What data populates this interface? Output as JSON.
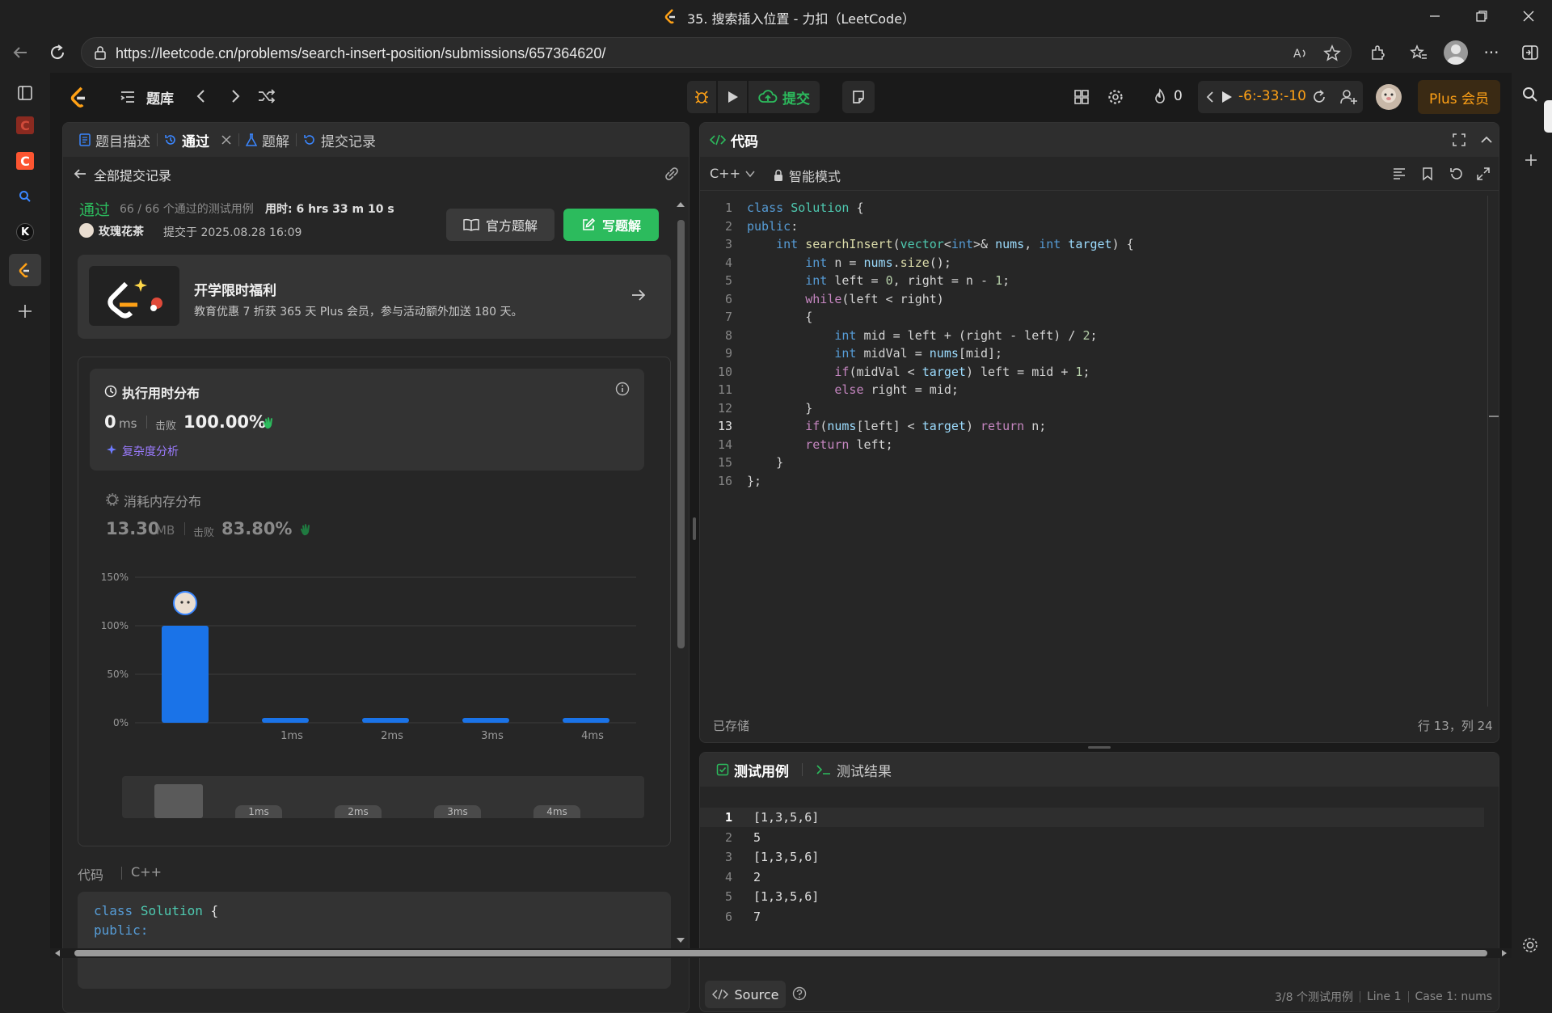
{
  "window": {
    "title": "35. 搜索插入位置 - 力扣（LeetCode）"
  },
  "browser": {
    "url": "https://leetcode.cn/problems/search-insert-position/submissions/657364620/"
  },
  "nav": {
    "problem_list": "题库",
    "submit": "提交",
    "streak": "0",
    "timer": "-6:-33:-10",
    "plus": "Plus 会员"
  },
  "left_tabs": [
    {
      "label": "题目描述"
    },
    {
      "label": "通过"
    },
    {
      "label": "题解"
    },
    {
      "label": "提交记录"
    }
  ],
  "submission": {
    "back": "全部提交记录",
    "status": "通过",
    "cases": "66 / 66 个通过的测试用例",
    "time_used": "用时: 6 hrs 33 m 10 s",
    "user": "玫瑰花茶",
    "submitted_at": "提交于 2025.08.28 16:09",
    "official_solution": "官方题解",
    "write_solution": "写题解"
  },
  "promo": {
    "title": "开学限时福利",
    "desc": "教育优惠 7 折获 365 天 Plus 会员，参与活动额外加送 180 天。"
  },
  "runtime": {
    "title": "执行用时分布",
    "value": "0",
    "unit": "ms",
    "beat_label": "击败",
    "beat": "100.00%",
    "analysis": "复杂度分析"
  },
  "memory": {
    "title": "消耗内存分布",
    "value": "13.30",
    "unit": "MB",
    "beat_label": "击败",
    "beat": "83.80%"
  },
  "chart_data": {
    "type": "bar",
    "categories": [
      "",
      "1ms",
      "2ms",
      "3ms",
      "4ms"
    ],
    "values": [
      100,
      3,
      3,
      3,
      3
    ],
    "yticks": [
      "150%",
      "100%",
      "50%",
      "0%"
    ],
    "ylim": [
      0,
      150
    ],
    "minimap_labels": [
      "1ms",
      "2ms",
      "3ms",
      "4ms"
    ]
  },
  "code_section": {
    "label": "代码",
    "lang": "C++",
    "preview": [
      "class Solution {",
      "public:"
    ]
  },
  "editor": {
    "title": "代码",
    "lang": "C++",
    "mode": "智能模式",
    "saved": "已存储",
    "cursor": "行 13，列 24",
    "lines": [
      "class Solution {",
      "public:",
      "    int searchInsert(vector<int>& nums, int target) {",
      "        int n = nums.size();",
      "        int left = 0, right = n - 1;",
      "        while(left < right)",
      "        {",
      "            int mid = left + (right - left) / 2;",
      "            int midVal = nums[mid];",
      "            if(midVal < target) left = mid + 1;",
      "            else right = mid;",
      "        }",
      "        if(nums[left] < target) return n;",
      "        return left;",
      "    }",
      "};"
    ]
  },
  "testcase": {
    "tab_cases": "测试用例",
    "tab_result": "测试结果",
    "lines": [
      "[1,3,5,6]",
      "5",
      "[1,3,5,6]",
      "2",
      "[1,3,5,6]",
      "7"
    ],
    "source": "Source",
    "status": "3/8 个测试用例",
    "line": "Line 1",
    "case": "Case 1: nums"
  }
}
